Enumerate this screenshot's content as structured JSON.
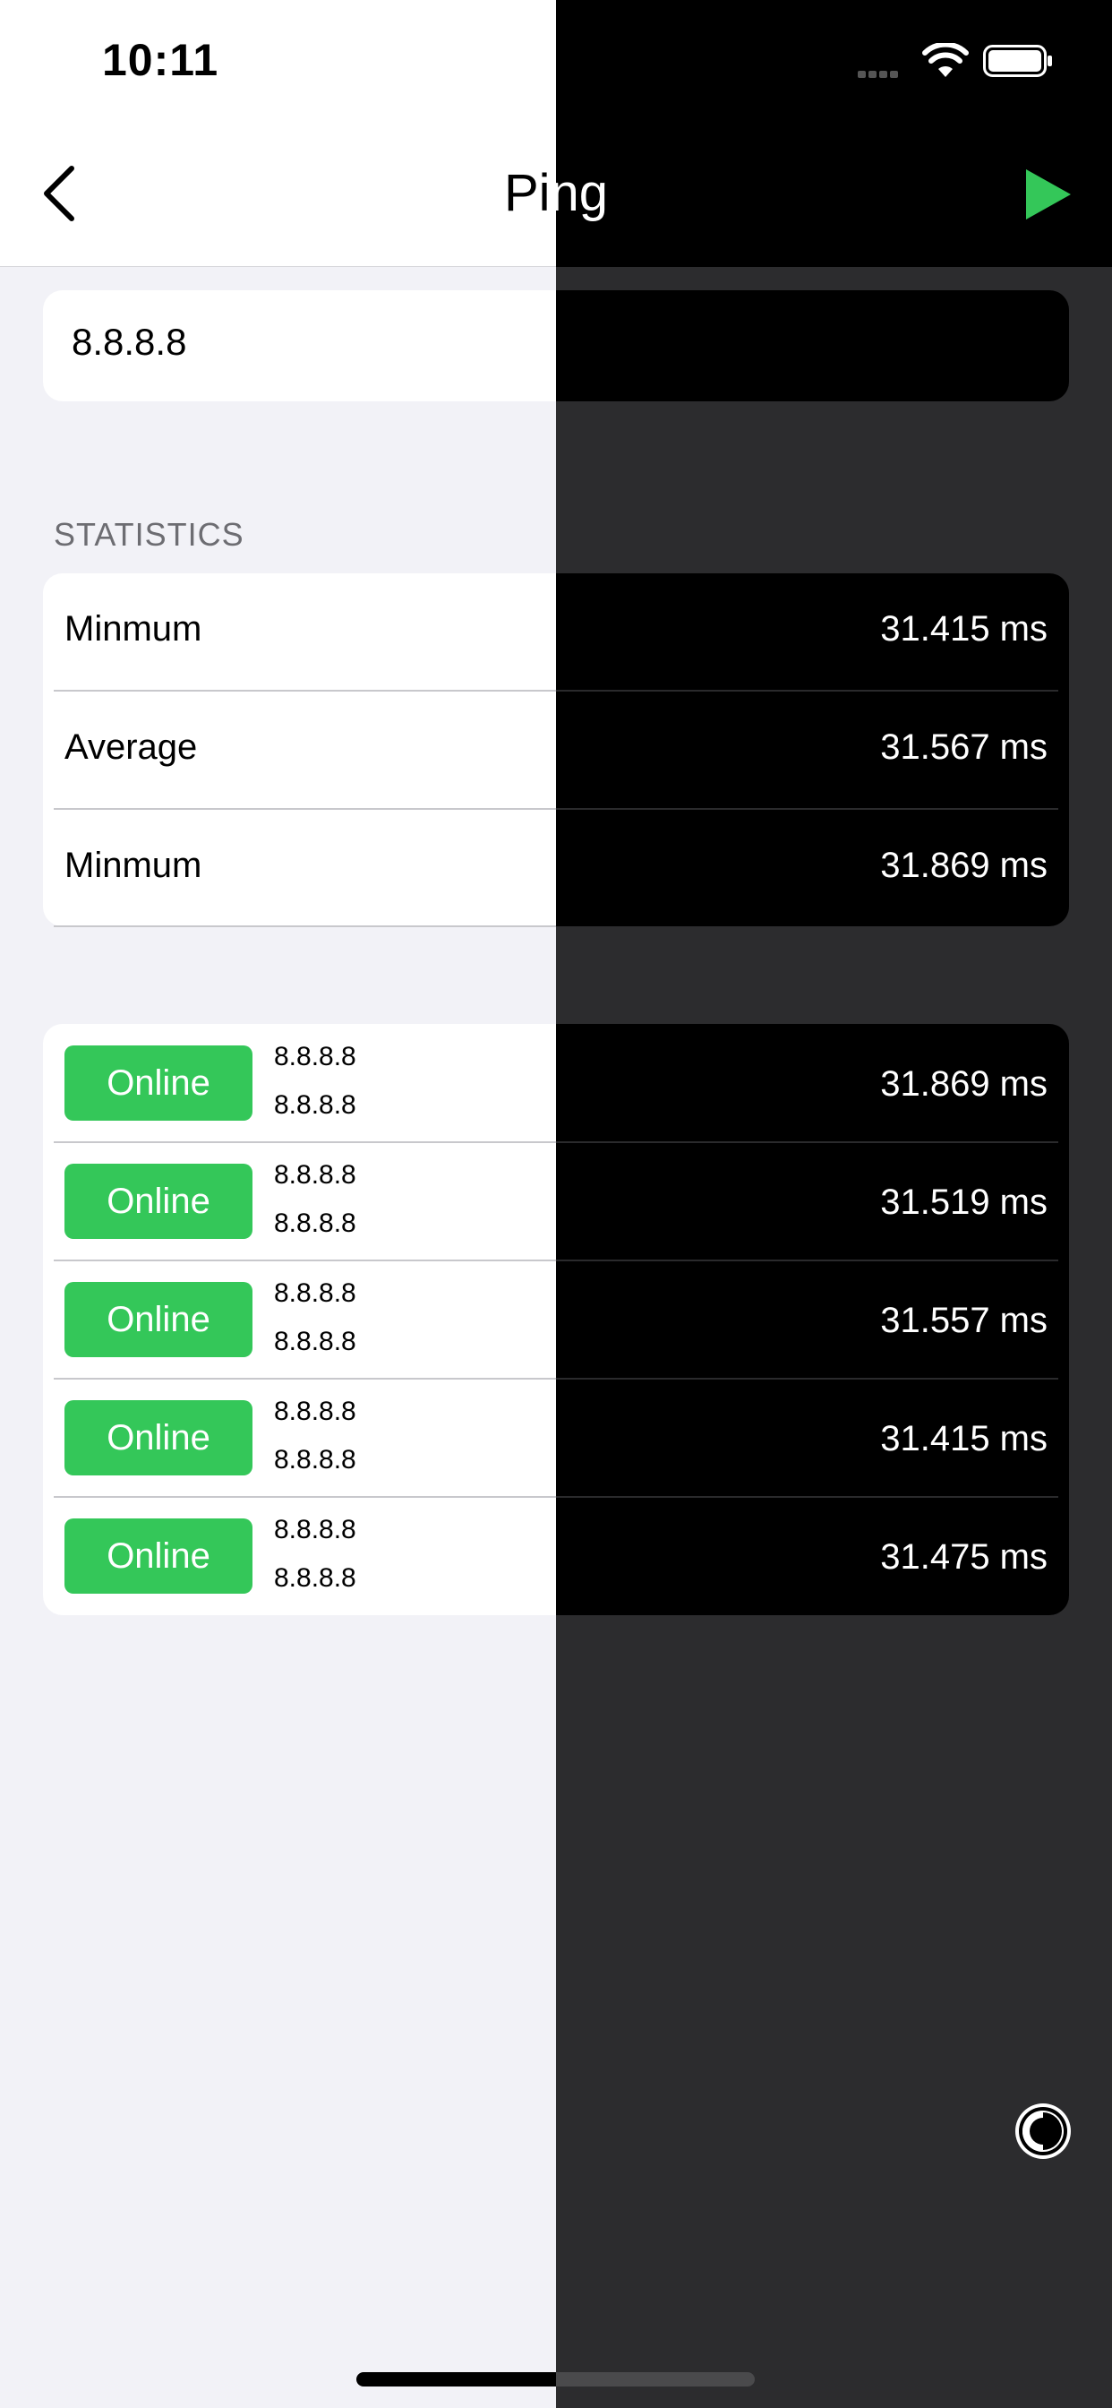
{
  "status_bar": {
    "time": "10:11"
  },
  "nav": {
    "title_light": "Pi",
    "title_dark": "ng"
  },
  "host": {
    "value": "8.8.8.8"
  },
  "statistics": {
    "header": "STATISTICS",
    "rows": [
      {
        "label": "Minmum",
        "value": "31.415 ms"
      },
      {
        "label": "Average",
        "value": "31.567 ms"
      },
      {
        "label": "Minmum",
        "value": "31.869 ms"
      }
    ]
  },
  "results": [
    {
      "status": "Online",
      "ip": "8.8.8.8",
      "host": "8.8.8.8",
      "time": "31.869 ms"
    },
    {
      "status": "Online",
      "ip": "8.8.8.8",
      "host": "8.8.8.8",
      "time": "31.519 ms"
    },
    {
      "status": "Online",
      "ip": "8.8.8.8",
      "host": "8.8.8.8",
      "time": "31.557 ms"
    },
    {
      "status": "Online",
      "ip": "8.8.8.8",
      "host": "8.8.8.8",
      "time": "31.415 ms"
    },
    {
      "status": "Online",
      "ip": "8.8.8.8",
      "host": "8.8.8.8",
      "time": "31.475 ms"
    }
  ],
  "icons": {
    "back": "chevron-left-icon",
    "play": "play-icon",
    "theme": "theme-toggle-icon"
  },
  "colors": {
    "accent_green": "#34c759",
    "light_bg": "#f2f2f7",
    "dark_bg": "#2c2c2e"
  }
}
